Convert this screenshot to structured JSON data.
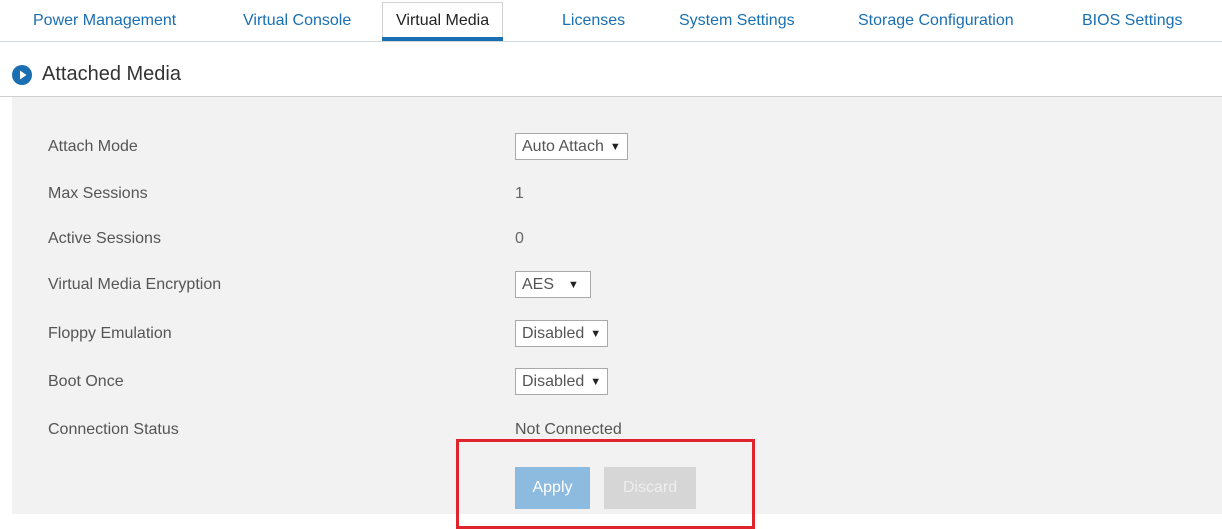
{
  "tabs": [
    {
      "label": "Power Management"
    },
    {
      "label": "Virtual Console"
    },
    {
      "label": "Virtual Media"
    },
    {
      "label": "Licenses"
    },
    {
      "label": "System Settings"
    },
    {
      "label": "Storage Configuration"
    },
    {
      "label": "BIOS Settings"
    }
  ],
  "active_tab": "Virtual Media",
  "section": {
    "title": "Attached Media",
    "icon": "play-circle-icon"
  },
  "form": {
    "attach_mode": {
      "label": "Attach Mode",
      "value": "Auto Attach"
    },
    "max_sessions": {
      "label": "Max Sessions",
      "value": "1"
    },
    "active_sessions": {
      "label": "Active Sessions",
      "value": "0"
    },
    "encryption": {
      "label": "Virtual Media Encryption",
      "value": "AES"
    },
    "floppy_emulation": {
      "label": "Floppy Emulation",
      "value": "Disabled"
    },
    "boot_once": {
      "label": "Boot Once",
      "value": "Disabled"
    },
    "connection_status": {
      "label": "Connection Status",
      "value": "Not Connected"
    }
  },
  "buttons": {
    "apply": "Apply",
    "discard": "Discard"
  },
  "colors": {
    "accent": "#1a6fb2",
    "apply_button": "#8dbbe0",
    "discard_button": "#d6d6d6",
    "highlight": "#e0242c",
    "panel_background": "#f2f2f2"
  }
}
